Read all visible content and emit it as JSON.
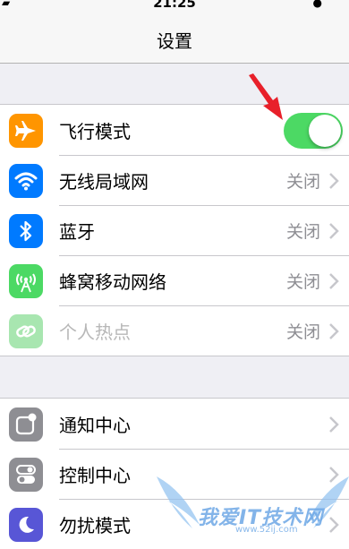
{
  "status_bar": {
    "time": "21:25"
  },
  "nav": {
    "title": "设置"
  },
  "group1": [
    {
      "label": "飞行模式",
      "icon": "airplane-icon",
      "color": "#ff9500",
      "toggle": "on"
    },
    {
      "label": "无线局域网",
      "value": "关闭",
      "icon": "wifi-icon",
      "color": "#007aff"
    },
    {
      "label": "蓝牙",
      "value": "关闭",
      "icon": "bluetooth-icon",
      "color": "#007aff"
    },
    {
      "label": "蜂窝移动网络",
      "value": "关闭",
      "icon": "cellular-antenna-icon",
      "color": "#4cd964"
    },
    {
      "label": "个人热点",
      "value": "关闭",
      "icon": "hotspot-link-icon",
      "color": "#a8e6b0"
    }
  ],
  "group2": [
    {
      "label": "通知中心",
      "icon": "notification-center-icon",
      "color": "#8e8e93"
    },
    {
      "label": "控制中心",
      "icon": "control-center-icon",
      "color": "#8e8e93"
    },
    {
      "label": "勿扰模式",
      "icon": "moon-icon",
      "color": "#5856d6"
    }
  ],
  "watermark": {
    "text": "我爱IT技术网",
    "url": "www.52ij.com"
  },
  "colors": {
    "toggle_on": "#4cd964",
    "arrow": "#e8202a"
  }
}
